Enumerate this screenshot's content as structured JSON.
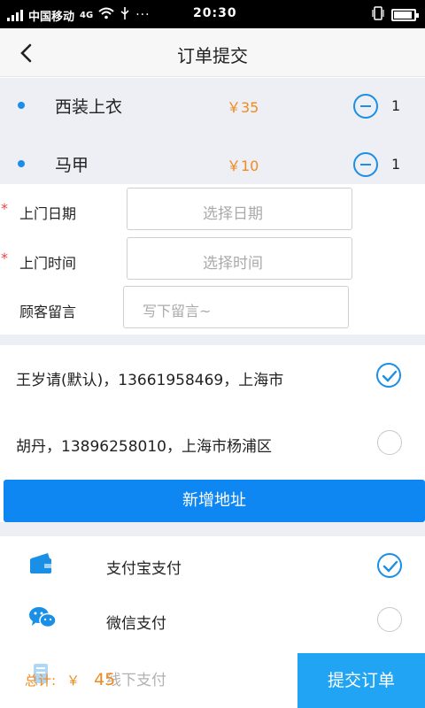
{
  "status_bar": {
    "carrier": "中国移动",
    "network": "4G",
    "time": "20:30"
  },
  "header": {
    "title": "订单提交",
    "back_icon": "chevron-left-icon"
  },
  "items": [
    {
      "name": "西装上衣",
      "price": "￥35",
      "quantity": "1"
    },
    {
      "name": "马甲",
      "price": "￥10",
      "quantity": "1"
    }
  ],
  "form": {
    "date_label": "上门日期",
    "date_placeholder": "选择日期",
    "time_label": "上门时间",
    "time_placeholder": "选择时间",
    "message_label": "顾客留言",
    "message_placeholder": "写下留言~",
    "required_mark": "*"
  },
  "addresses": [
    {
      "text": "王岁请(默认)，13661958469，上海市",
      "selected": true
    },
    {
      "text": "胡丹，13896258010，上海市杨浦区",
      "selected": false
    }
  ],
  "add_address_label": "新增地址",
  "payments": [
    {
      "label": "支付宝支付",
      "icon": "alipay-wallet-icon",
      "selected": true
    },
    {
      "label": "微信支付",
      "icon": "wechat-icon",
      "selected": false
    },
    {
      "label": "线下支付",
      "icon": "offline-pay-icon",
      "selected": false
    }
  ],
  "footer": {
    "total_label": "总计:",
    "currency": "￥",
    "total_value": "45",
    "submit_label": "提交订单"
  },
  "colors": {
    "accent": "#1a8fe6",
    "button_blue": "#0f87f2",
    "price_orange": "#f08a1e",
    "required_red": "#e64545"
  }
}
